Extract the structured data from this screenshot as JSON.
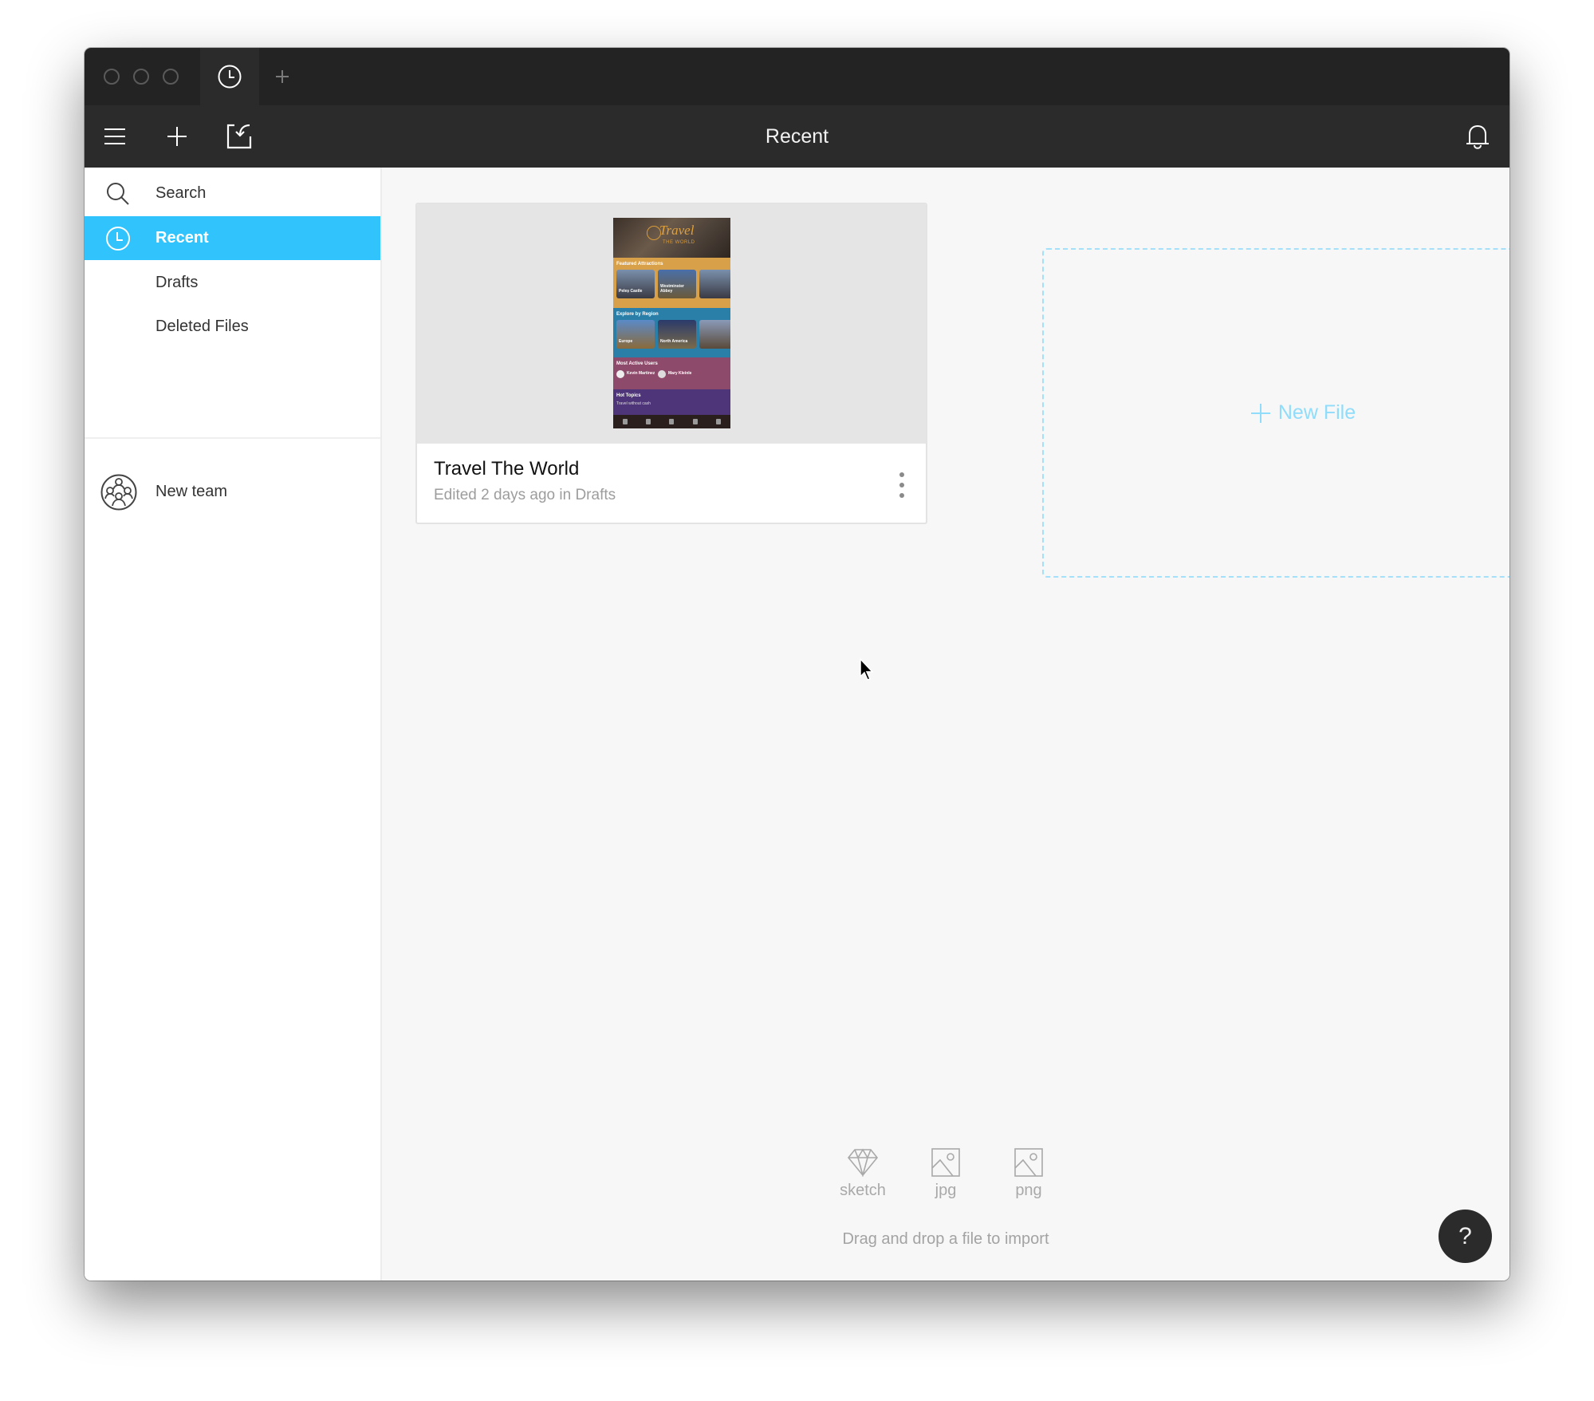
{
  "window": {
    "tabs": [
      {
        "icon": "clock-icon",
        "active": true
      }
    ],
    "new_tab_icon": "plus-icon"
  },
  "toolbar": {
    "title": "Recent",
    "menu_icon": "hamburger-menu-icon",
    "add_icon": "plus-icon",
    "import_icon": "import-icon",
    "notifications_icon": "bell-icon"
  },
  "sidebar": {
    "items": [
      {
        "label": "Search",
        "icon": "search-icon",
        "active": false
      },
      {
        "label": "Recent",
        "icon": "clock-icon",
        "active": true
      },
      {
        "label": "Drafts",
        "icon": null,
        "active": false
      },
      {
        "label": "Deleted Files",
        "icon": null,
        "active": false
      }
    ],
    "team": {
      "label": "New team",
      "icon": "team-icon"
    }
  },
  "files": [
    {
      "title": "Travel The World",
      "subtitle": "Edited 2 days ago in Drafts",
      "preview": {
        "app_title": "Travel",
        "app_subtitle": "THE WORLD",
        "sections": [
          {
            "heading": "Featured Attractions",
            "color": "#d9a04a",
            "tiles": [
              "Peleș Castle",
              "Westminster Abbey"
            ]
          },
          {
            "heading": "Explore by Region",
            "color": "#2a7fa8",
            "tiles": [
              "Europe",
              "North America"
            ]
          },
          {
            "heading": "Most Active Users",
            "color": "#8e4a6a",
            "tiles": [
              "Kevin Martinez",
              "Mary Kleinle"
            ]
          },
          {
            "heading": "Hot Topics",
            "color": "#4e3478",
            "tiles": [
              "Travel without cash"
            ]
          }
        ]
      }
    }
  ],
  "new_file": {
    "label": "New File"
  },
  "import": {
    "types": [
      {
        "label": "sketch",
        "icon": "diamond-icon"
      },
      {
        "label": "jpg",
        "icon": "image-icon"
      },
      {
        "label": "png",
        "icon": "image-icon"
      }
    ],
    "hint": "Drag and drop a file to import"
  },
  "help": {
    "label": "?"
  },
  "colors": {
    "accent": "#31c3fb",
    "new_file": "#8fdcfb",
    "titlebar": "#232323",
    "toolbar": "#2b2b2b"
  }
}
